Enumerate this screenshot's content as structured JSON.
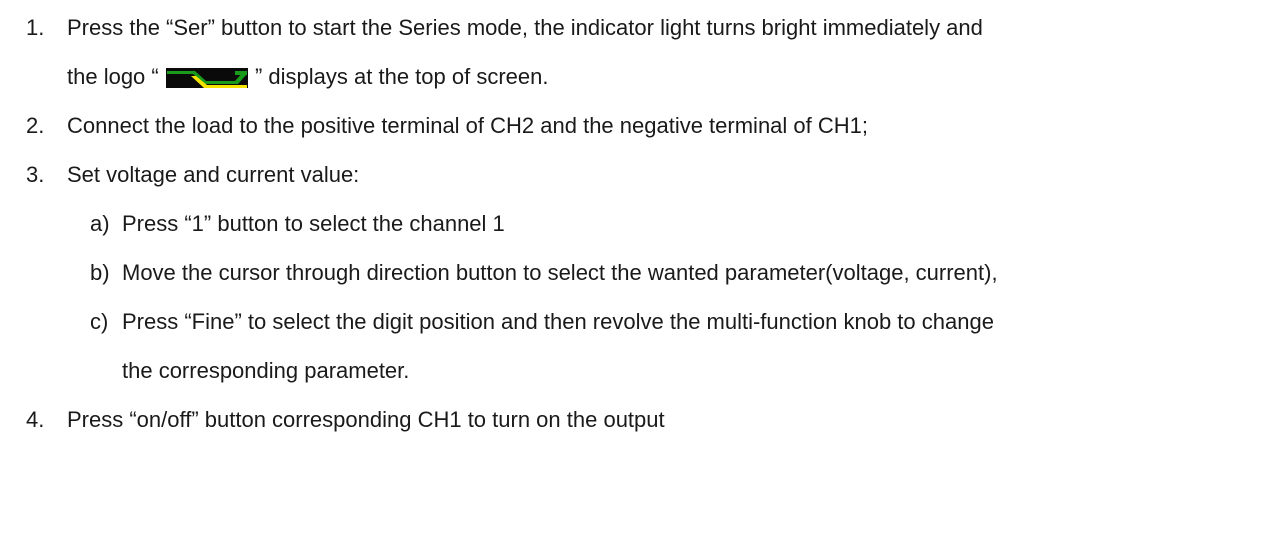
{
  "steps": [
    {
      "number": "1.",
      "text_line1": "Press the “Ser” button to start the Series mode, the indicator light turns bright immediately and",
      "text_line2_before": "the logo “",
      "text_line2_after": "” displays at the top of screen."
    },
    {
      "number": "2.",
      "text": "Connect the load to the positive terminal of CH2 and the negative terminal of CH1;"
    },
    {
      "number": "3.",
      "text": "Set voltage and current value:",
      "substeps": [
        {
          "letter": "a)",
          "text": "Press “1” button to select the channel 1"
        },
        {
          "letter": "b)",
          "text": "Move the cursor through direction button to select the wanted parameter(voltage, current),"
        },
        {
          "letter": "c)",
          "text_line1": "Press “Fine” to select the digit position and then revolve the multi-function knob to change",
          "text_line2": "the corresponding parameter."
        }
      ]
    },
    {
      "number": "4.",
      "text": "Press “on/off” button corresponding CH1 to turn on the output"
    }
  ],
  "logo": {
    "icon": "series-mode-logo-icon",
    "colors": {
      "green": "#1a9a1a",
      "yellow": "#f5e400",
      "background": "#0a0a0a"
    }
  }
}
